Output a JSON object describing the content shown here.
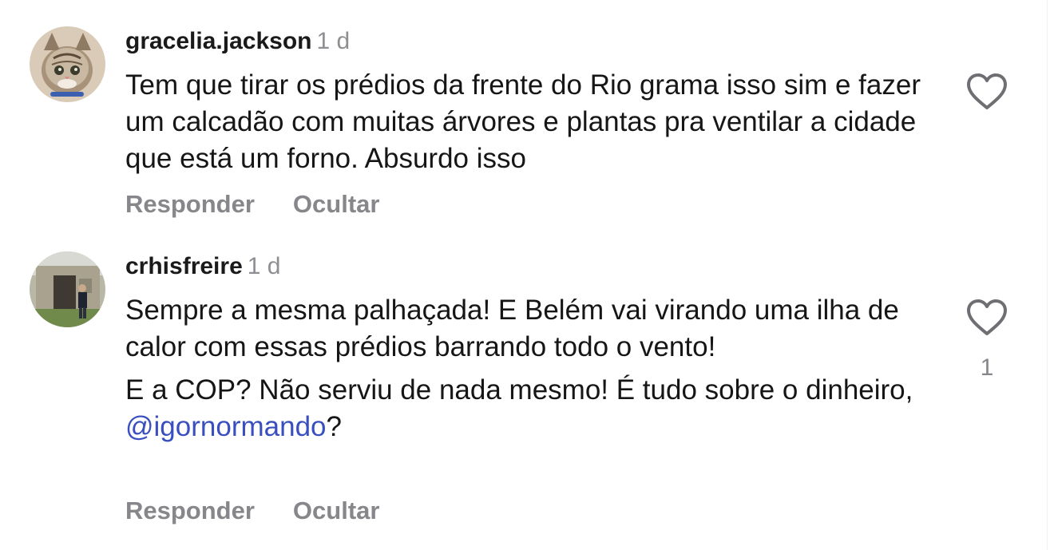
{
  "comments": [
    {
      "username": "gracelia.jackson",
      "time": "1 d",
      "paragraphs": [
        "Tem que tirar os prédios da frente do Rio grama isso sim e fazer um calcadão com muitas árvores e plantas pra ventilar a cidade que está um forno. Absurdo isso"
      ],
      "reply_label": "Responder",
      "hide_label": "Ocultar",
      "like_count": "",
      "avatar_icon": "cat-photo"
    },
    {
      "username": "crhisfreire",
      "time": "1 d",
      "paragraphs": [
        "Sempre a mesma palhaçada! E Belém vai virando uma ilha de calor com essas prédios barrando todo o vento!"
      ],
      "last_paragraph_prefix": "E a COP? Não serviu de nada mesmo! É tudo sobre o dinheiro, ",
      "mention": "@igornormando",
      "last_paragraph_suffix": "?",
      "reply_label": "Responder",
      "hide_label": "Ocultar",
      "like_count": "1",
      "avatar_icon": "person-at-door-photo"
    }
  ],
  "colors": {
    "meta_gray": "#8e8e93",
    "action_gray": "#86868b",
    "mention_blue": "#3a4fbf",
    "heart_stroke": "#6e6e73"
  }
}
